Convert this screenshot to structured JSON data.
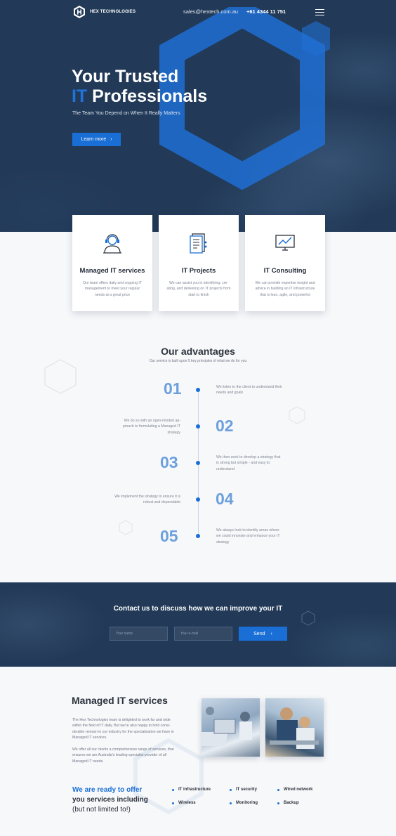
{
  "header": {
    "logo_text": "HEX TECHNOLOGIES",
    "email": "sales@hextech.com.au",
    "phone": "+61 4344 11 751"
  },
  "hero": {
    "title_line1": "Your Trusted",
    "title_accent": "IT",
    "title_line2_rest": " Professionals",
    "subtitle": "The Team You Depend on When It Really Matters",
    "cta_label": "Learn more"
  },
  "cards": [
    {
      "title": "Managed IT services",
      "text": "Our team offers daily and ongoing IT management to meet your regular needs at a great price",
      "icon": "support-agent-icon"
    },
    {
      "title": "IT Projects",
      "text": "We can assist you in identifying, cre-ating, and delivering on IT projects from start to finish",
      "icon": "document-icon"
    },
    {
      "title": "IT Consulting",
      "text": "We can provide expertise insight and advice in building an IT infrastructure that is lean, agile, and powerful",
      "icon": "chart-monitor-icon"
    }
  ],
  "advantages": {
    "title": "Our advantages",
    "subtitle": "Our service is built upon 5 key principles of what we do for you",
    "steps": [
      {
        "num": "01",
        "text": "We listen to the client to understand their needs and goals"
      },
      {
        "num": "02",
        "text": "We do so with an open-minded ap-proach to formulating a Managed IT strategy"
      },
      {
        "num": "03",
        "text": "We then seek to develop a strategy that is strong but simple - and easy to understand"
      },
      {
        "num": "04",
        "text": "We implement the strategy to ensure it is robust and dependable"
      },
      {
        "num": "05",
        "text": "We always look to identify areas where we could innovate and enhance your IT strategy"
      }
    ]
  },
  "contact": {
    "title": "Contact us to discuss how we can improve your IT",
    "name_placeholder": "Your name",
    "email_placeholder": "Your e-mail",
    "send_label": "Send"
  },
  "managed": {
    "title": "Managed IT services",
    "para1": "The Hex Technologies team is delighted to work far and wide within the field of IT daily. But we're also happy to hold consi-derable renown in our industry for the specialisation we have in Managed IT services.",
    "para2": "We offer all our clients a comprehensive range of services, that ensures we are Australia's leading specialist provider of all Managed IT needs.",
    "ready_line1": "We are ready to offer",
    "ready_line2": "you services including",
    "ready_line3": "(but not limited to!)",
    "services": [
      "IT infrastructure",
      "IT security",
      "Wired network",
      "Wireless",
      "Monitoring",
      "Backup"
    ]
  },
  "colors": {
    "accent": "#1a6fd6",
    "navy": "#223a57",
    "number": "#6ca0dd"
  }
}
